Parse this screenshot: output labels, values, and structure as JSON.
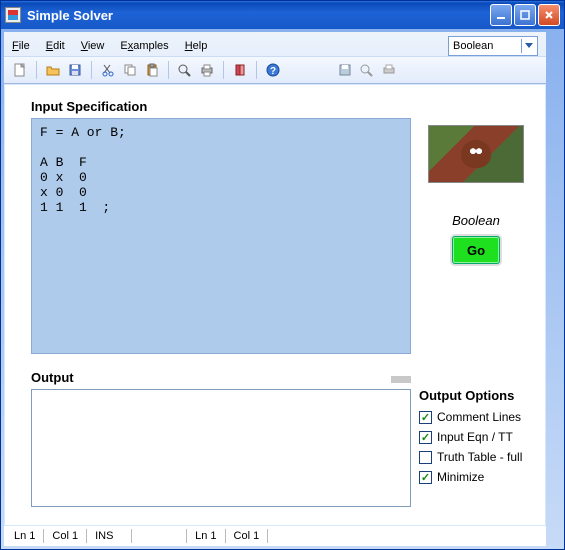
{
  "window": {
    "title": "Simple Solver"
  },
  "menu": {
    "file": "File",
    "edit": "Edit",
    "view": "View",
    "examples": "Examples",
    "help": "Help"
  },
  "mode_select": {
    "value": "Boolean"
  },
  "input": {
    "heading": "Input Specification",
    "text": "F = A or B;\n\nA B  F\n0 x  0\nx 0  0\n1 1  1  ;"
  },
  "output": {
    "heading": "Output",
    "text": ""
  },
  "sidebar": {
    "mode_label": "Boolean",
    "go_label": "Go",
    "options_heading": "Output Options",
    "opts": [
      {
        "label": "Comment Lines",
        "checked": true
      },
      {
        "label": "Input Eqn / TT",
        "checked": true
      },
      {
        "label": "Truth Table - full",
        "checked": false
      },
      {
        "label": "Minimize",
        "checked": true
      }
    ]
  },
  "status": {
    "ln1": "Ln 1",
    "col1": "Col 1",
    "ins": "INS",
    "ln2": "Ln 1",
    "col2": "Col 1"
  }
}
